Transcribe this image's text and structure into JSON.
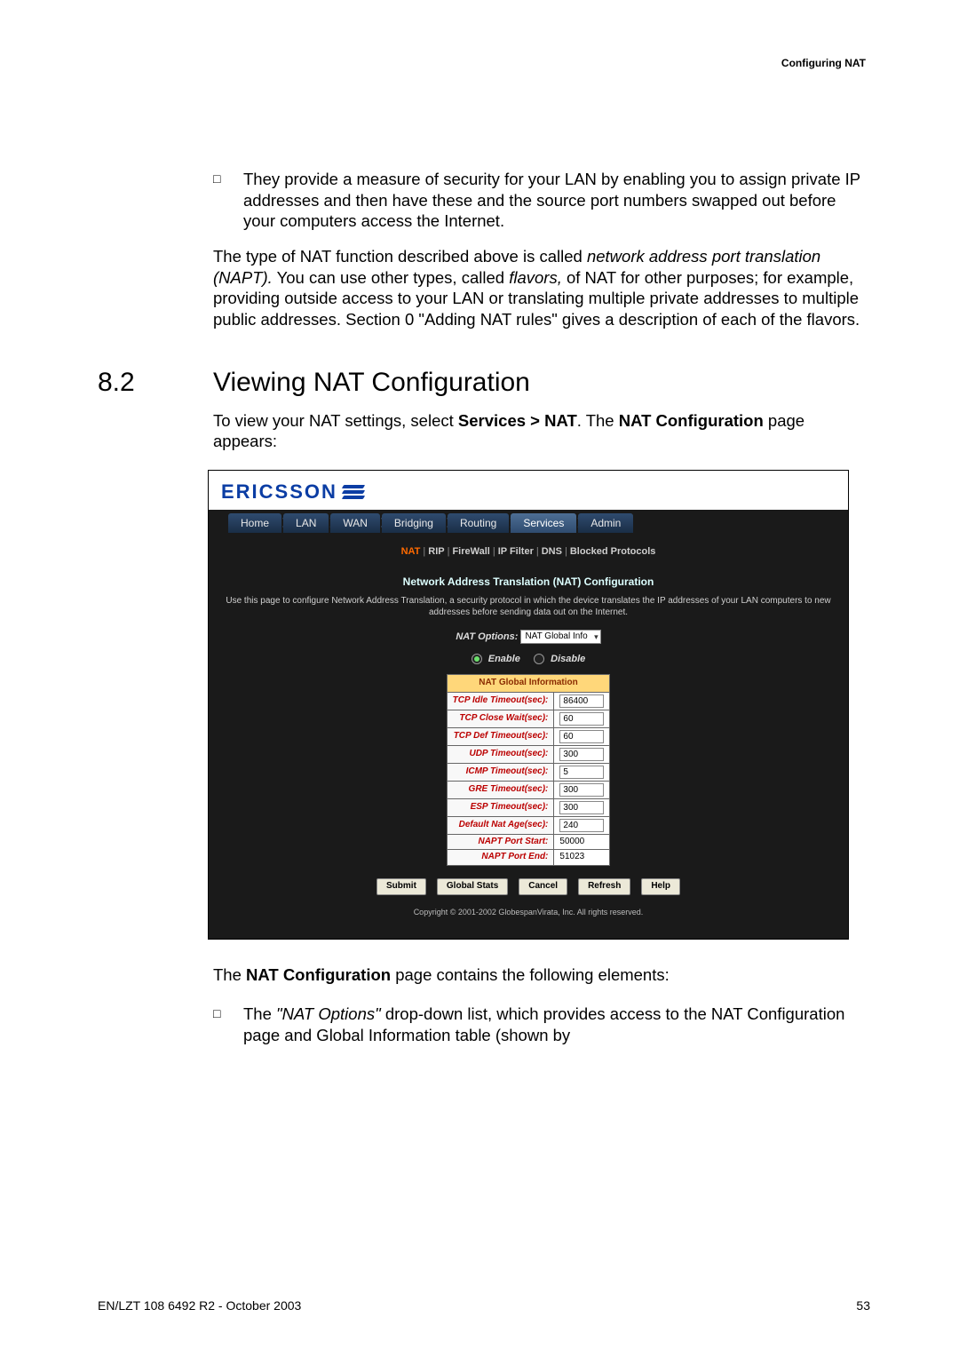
{
  "header_right": "Configuring NAT",
  "bullet1": "They provide a measure of security for your LAN by enabling you to assign private IP addresses and then have these and the source port numbers swapped out before your computers access the Internet.",
  "para1_a": "The type of NAT function described above is called ",
  "para1_i1": "network address port translation (NAPT).",
  "para1_b": " You can use other types, called ",
  "para1_i2": "flavors,",
  "para1_c": " of NAT for other purposes; for example, providing outside access to your LAN or translating multiple private addresses to multiple public addresses. Section 0 \"Adding NAT rules\" gives a description of each of the flavors.",
  "sec_num": "8.2",
  "sec_title": "Viewing NAT Configuration",
  "intro_a": "To view your NAT settings, select ",
  "intro_b": "Services > NAT",
  "intro_c": ". The ",
  "intro_d": "NAT Configuration",
  "intro_e": " page appears:",
  "brand": "ERICSSON",
  "tabs": [
    "Home",
    "LAN",
    "WAN",
    "Bridging",
    "Routing",
    "Services",
    "Admin"
  ],
  "subnav": {
    "current": "NAT",
    "items": [
      "RIP",
      "FireWall",
      "IP Filter",
      "DNS",
      "Blocked Protocols"
    ]
  },
  "cfg_title": "Network Address Translation (NAT) Configuration",
  "cfg_desc": "Use this page to configure Network Address Translation, a security protocol in which the device translates the IP addresses of your LAN computers to new addresses before sending data out on the Internet.",
  "nat_options_label": "NAT Options:",
  "nat_options_value": "NAT Global Info",
  "enable_label": "Enable",
  "disable_label": "Disable",
  "table_header": "NAT Global Information",
  "rows": [
    {
      "label": "TCP Idle Timeout(sec):",
      "value": "86400",
      "editable": true
    },
    {
      "label": "TCP Close Wait(sec):",
      "value": "60",
      "editable": true
    },
    {
      "label": "TCP Def Timeout(sec):",
      "value": "60",
      "editable": true
    },
    {
      "label": "UDP Timeout(sec):",
      "value": "300",
      "editable": true
    },
    {
      "label": "ICMP Timeout(sec):",
      "value": "5",
      "editable": true
    },
    {
      "label": "GRE Timeout(sec):",
      "value": "300",
      "editable": true
    },
    {
      "label": "ESP Timeout(sec):",
      "value": "300",
      "editable": true
    },
    {
      "label": "Default Nat Age(sec):",
      "value": "240",
      "editable": true
    },
    {
      "label": "NAPT Port Start:",
      "value": "50000",
      "editable": false
    },
    {
      "label": "NAPT Port End:",
      "value": "51023",
      "editable": false
    }
  ],
  "buttons": [
    "Submit",
    "Global Stats",
    "Cancel",
    "Refresh",
    "Help"
  ],
  "copyright": "Copyright © 2001-2002 GlobespanVirata, Inc. All rights reserved.",
  "after1_a": "The ",
  "after1_b": "NAT Configuration",
  "after1_c": " page contains the following elements:",
  "bullet2_a": "The ",
  "bullet2_b": "\"NAT Options\"",
  "bullet2_c": " drop-down list, which provides access to the NAT Configuration page and Global Information table (shown by",
  "footer_left": "EN/LZT 108 6492 R2 - October 2003",
  "footer_right": "53"
}
